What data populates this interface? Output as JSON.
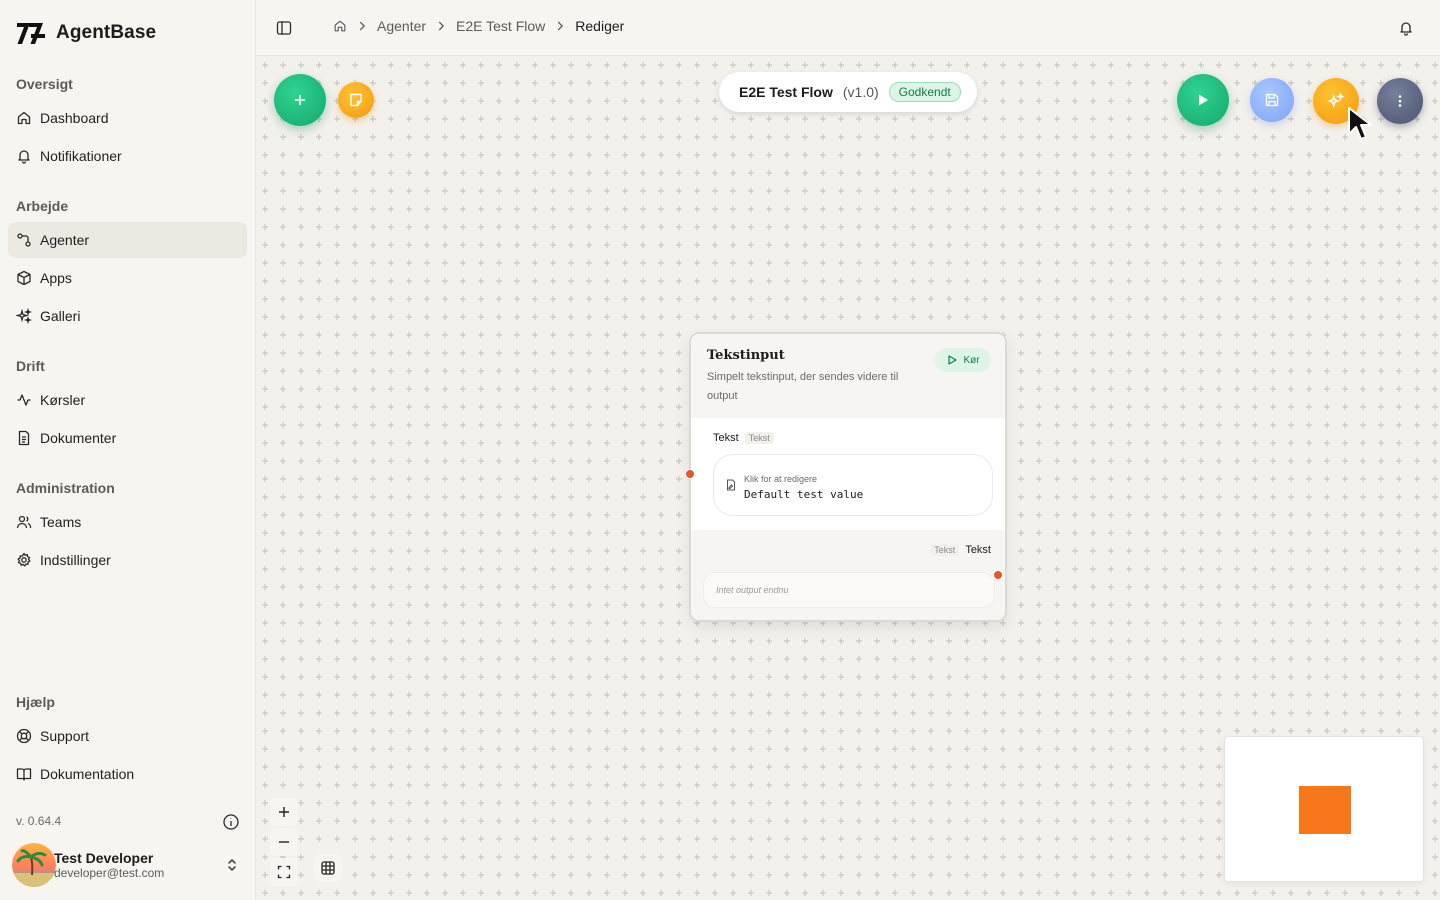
{
  "brand": {
    "name": "AgentBase"
  },
  "sidebar": {
    "sections": [
      {
        "title": "Oversigt",
        "items": [
          {
            "label": "Dashboard",
            "icon": "home-icon"
          },
          {
            "label": "Notifikationer",
            "icon": "bell-icon"
          }
        ]
      },
      {
        "title": "Arbejde",
        "items": [
          {
            "label": "Agenter",
            "icon": "workflow-icon",
            "active": true
          },
          {
            "label": "Apps",
            "icon": "box-icon"
          },
          {
            "label": "Galleri",
            "icon": "sparkles-icon"
          }
        ]
      },
      {
        "title": "Drift",
        "items": [
          {
            "label": "Kørsler",
            "icon": "activity-icon"
          },
          {
            "label": "Dokumenter",
            "icon": "document-icon"
          }
        ]
      },
      {
        "title": "Administration",
        "items": [
          {
            "label": "Teams",
            "icon": "users-icon"
          },
          {
            "label": "Indstillinger",
            "icon": "gear-icon"
          }
        ]
      },
      {
        "title": "Hjælp",
        "items": [
          {
            "label": "Support",
            "icon": "lifebuoy-icon"
          },
          {
            "label": "Dokumentation",
            "icon": "book-icon"
          }
        ]
      }
    ],
    "version": "v. 0.64.4",
    "user": {
      "name": "Test Developer",
      "email": "developer@test.com"
    }
  },
  "breadcrumb": {
    "items": [
      "Agenter",
      "E2E Test Flow"
    ],
    "current": "Rediger"
  },
  "flow": {
    "name": "E2E Test Flow",
    "version": "(v1.0)",
    "status": "Godkendt"
  },
  "node": {
    "title": "Tekstinput",
    "description": "Simpelt tekstinput, der sendes videre til output",
    "run_label": "Kør",
    "input_label": "Tekst",
    "input_type": "Tekst",
    "edit_hint": "Klik for at redigere",
    "input_value": "Default test value",
    "output_type": "Tekst",
    "output_label": "Tekst",
    "output_placeholder": "Intet output endnu"
  },
  "colors": {
    "accent_green": "#15a86a",
    "accent_orange": "#f29b0c",
    "handle": "#e4572e",
    "minimap_node": "#f6781a"
  }
}
